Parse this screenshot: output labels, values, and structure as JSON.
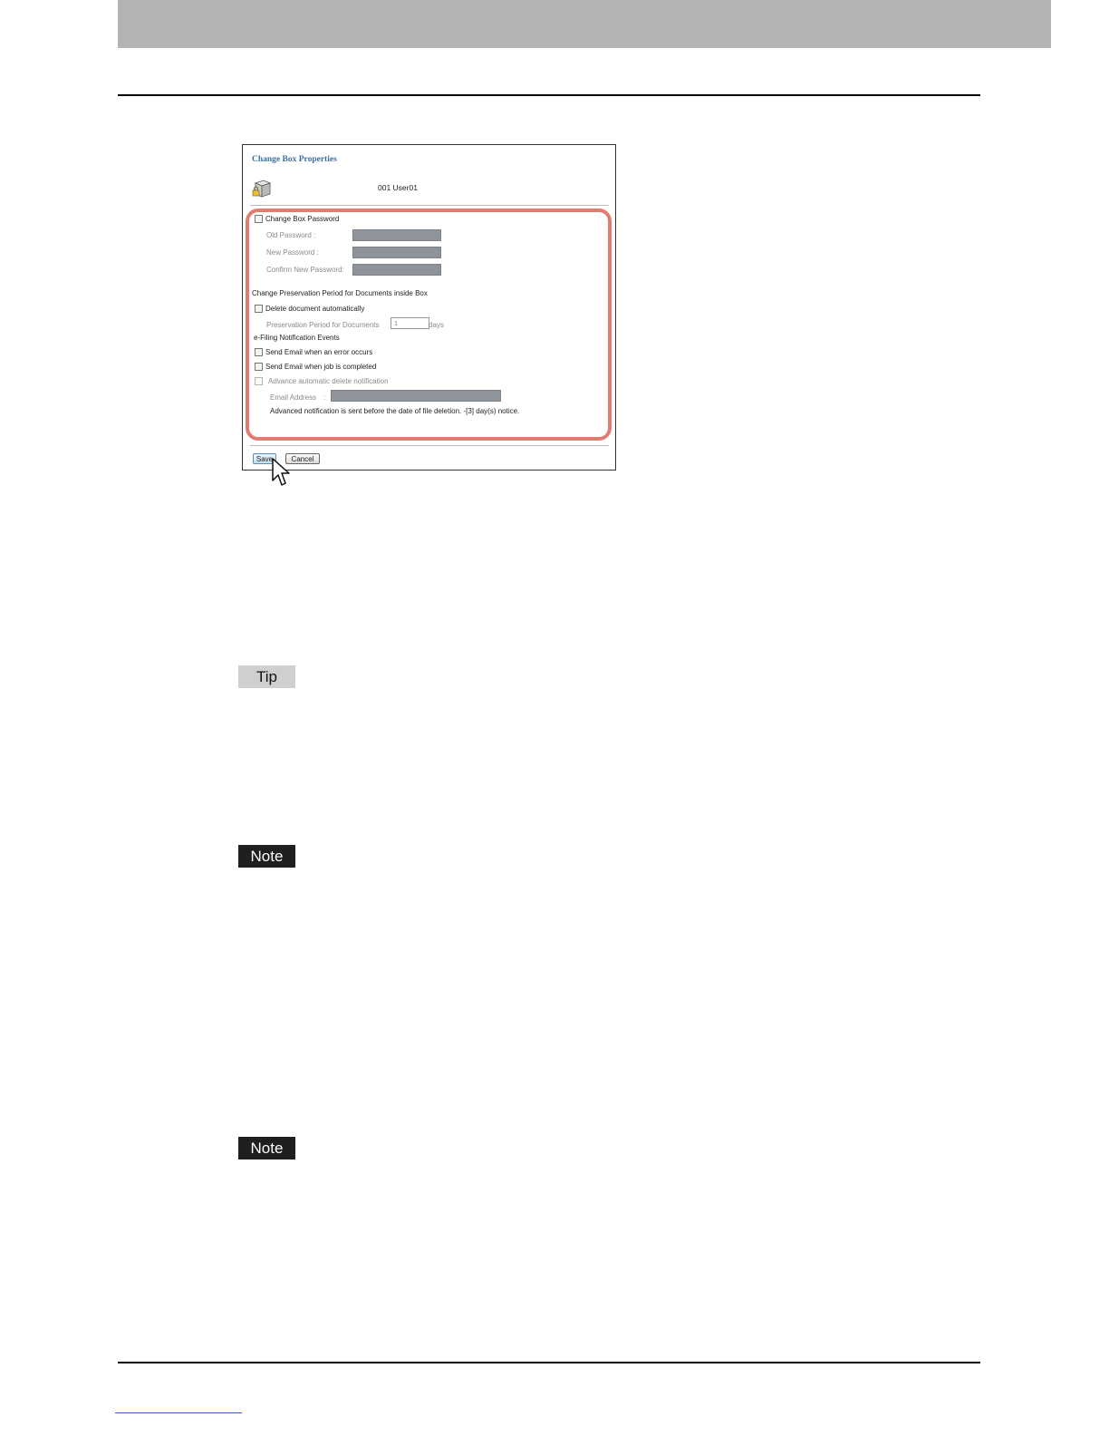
{
  "dialog": {
    "title": "Change Box Properties",
    "box_name": "001 User01"
  },
  "form": {
    "change_password_label": "Change Box Password",
    "old_password_label": "Old Password :",
    "new_password_label": "New Password :",
    "confirm_password_label": "Confirm New Password:",
    "preservation_heading": "Change Preservation Period for Documents inside Box",
    "delete_auto_label": "Delete document automatically",
    "preservation_period_label": "Preservation Period for Documents",
    "preservation_period_value": "1",
    "days_label": "days",
    "notification_heading": "e-Filing Notification Events",
    "email_error_label": "Send Email when an error occurs",
    "email_complete_label": "Send Email when job is completed",
    "advance_delete_label": "Advance automatic delete notification",
    "email_address_label": "Email Address",
    "email_address_colon": ":",
    "advance_note": "Advanced notification is sent before the date of file deletion. -[3] day(s) notice."
  },
  "buttons": {
    "save": "Save",
    "cancel": "Cancel"
  },
  "labels": {
    "tip": "Tip",
    "note1": "Note",
    "note2": "Note"
  },
  "colors": {
    "highlight": "#e07c70",
    "title_blue": "#3b6ea5",
    "header_band": "#b3b3b3"
  }
}
